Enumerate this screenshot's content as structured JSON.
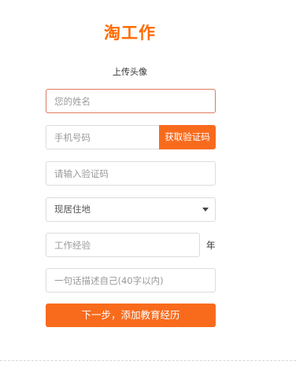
{
  "header": {
    "logo_text": "淘工作",
    "upload_label": "上传头像"
  },
  "form": {
    "name_placeholder": "您的姓名",
    "phone_placeholder": "手机号码",
    "get_code_label": "获取验证码",
    "code_placeholder": "请输入验证码",
    "residence_value": "现居住地",
    "experience_placeholder": "工作经验",
    "year_unit": "年",
    "description_placeholder": "一句话描述自己(40字以内)",
    "next_label": "下一步，添加教育经历"
  },
  "colors": {
    "accent": "#f86b1d",
    "active_border": "#e07860"
  },
  "icons": {
    "dropdown": "chevron-down-icon"
  }
}
